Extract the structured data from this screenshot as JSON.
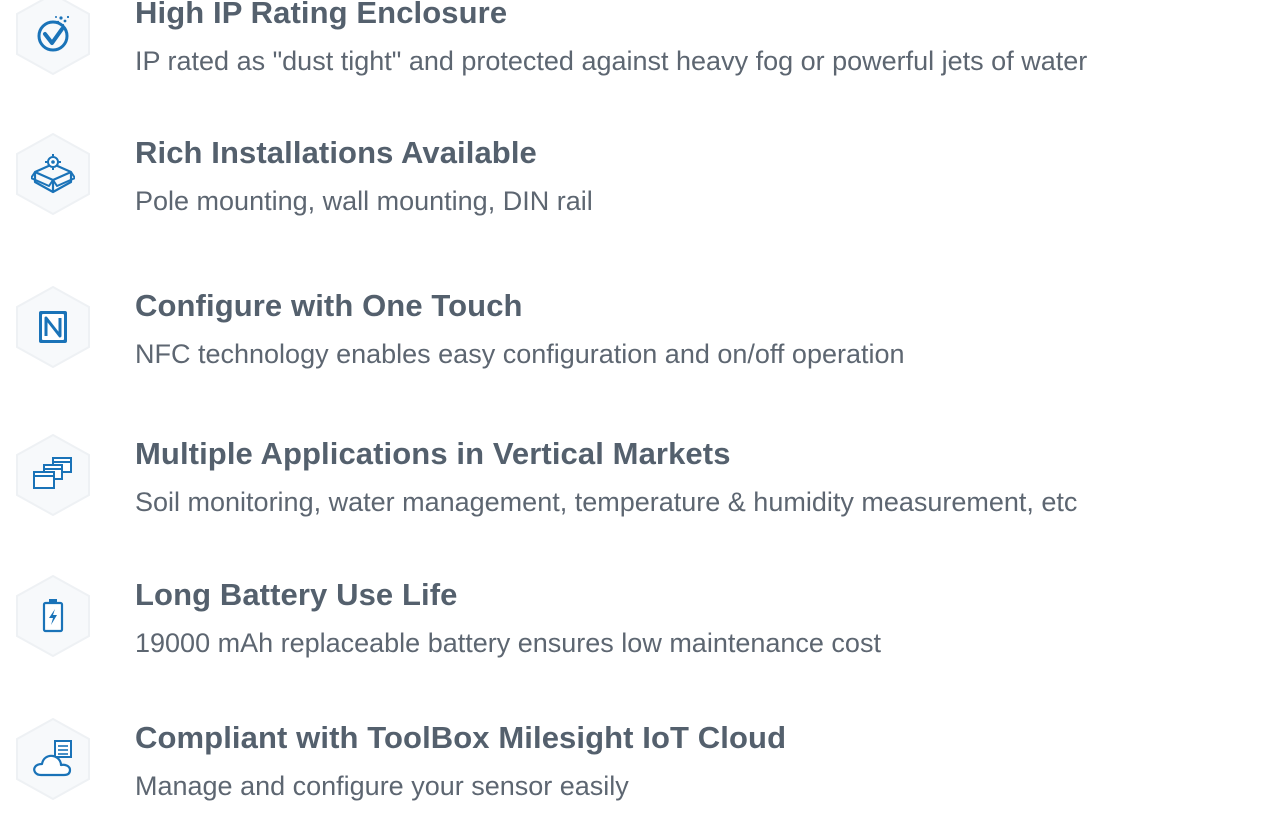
{
  "colors": {
    "accent": "#1a73b8",
    "title": "#54606d",
    "text": "#5d6671",
    "hex_fill": "#f7f9fb",
    "hex_stroke": "#eef1f4"
  },
  "features": [
    {
      "icon": "waterproof-check-icon",
      "title": "High IP Rating Enclosure",
      "description": "IP rated as \"dust tight\" and protected against heavy fog or powerful jets of water"
    },
    {
      "icon": "installation-box-icon",
      "title": "Rich Installations Available",
      "description": "Pole mounting, wall mounting, DIN rail"
    },
    {
      "icon": "nfc-icon",
      "title": "Configure with One Touch",
      "description": "NFC technology enables easy configuration and on/off operation"
    },
    {
      "icon": "stacked-windows-icon",
      "title": "Multiple Applications in Vertical Markets",
      "description": "Soil monitoring, water management, temperature & humidity measurement, etc"
    },
    {
      "icon": "battery-icon",
      "title": "Long Battery Use Life",
      "description": "19000 mAh replaceable battery ensures low maintenance cost"
    },
    {
      "icon": "cloud-server-icon",
      "title": "Compliant with ToolBox Milesight IoT Cloud",
      "description": "Manage and configure your sensor easily"
    }
  ]
}
